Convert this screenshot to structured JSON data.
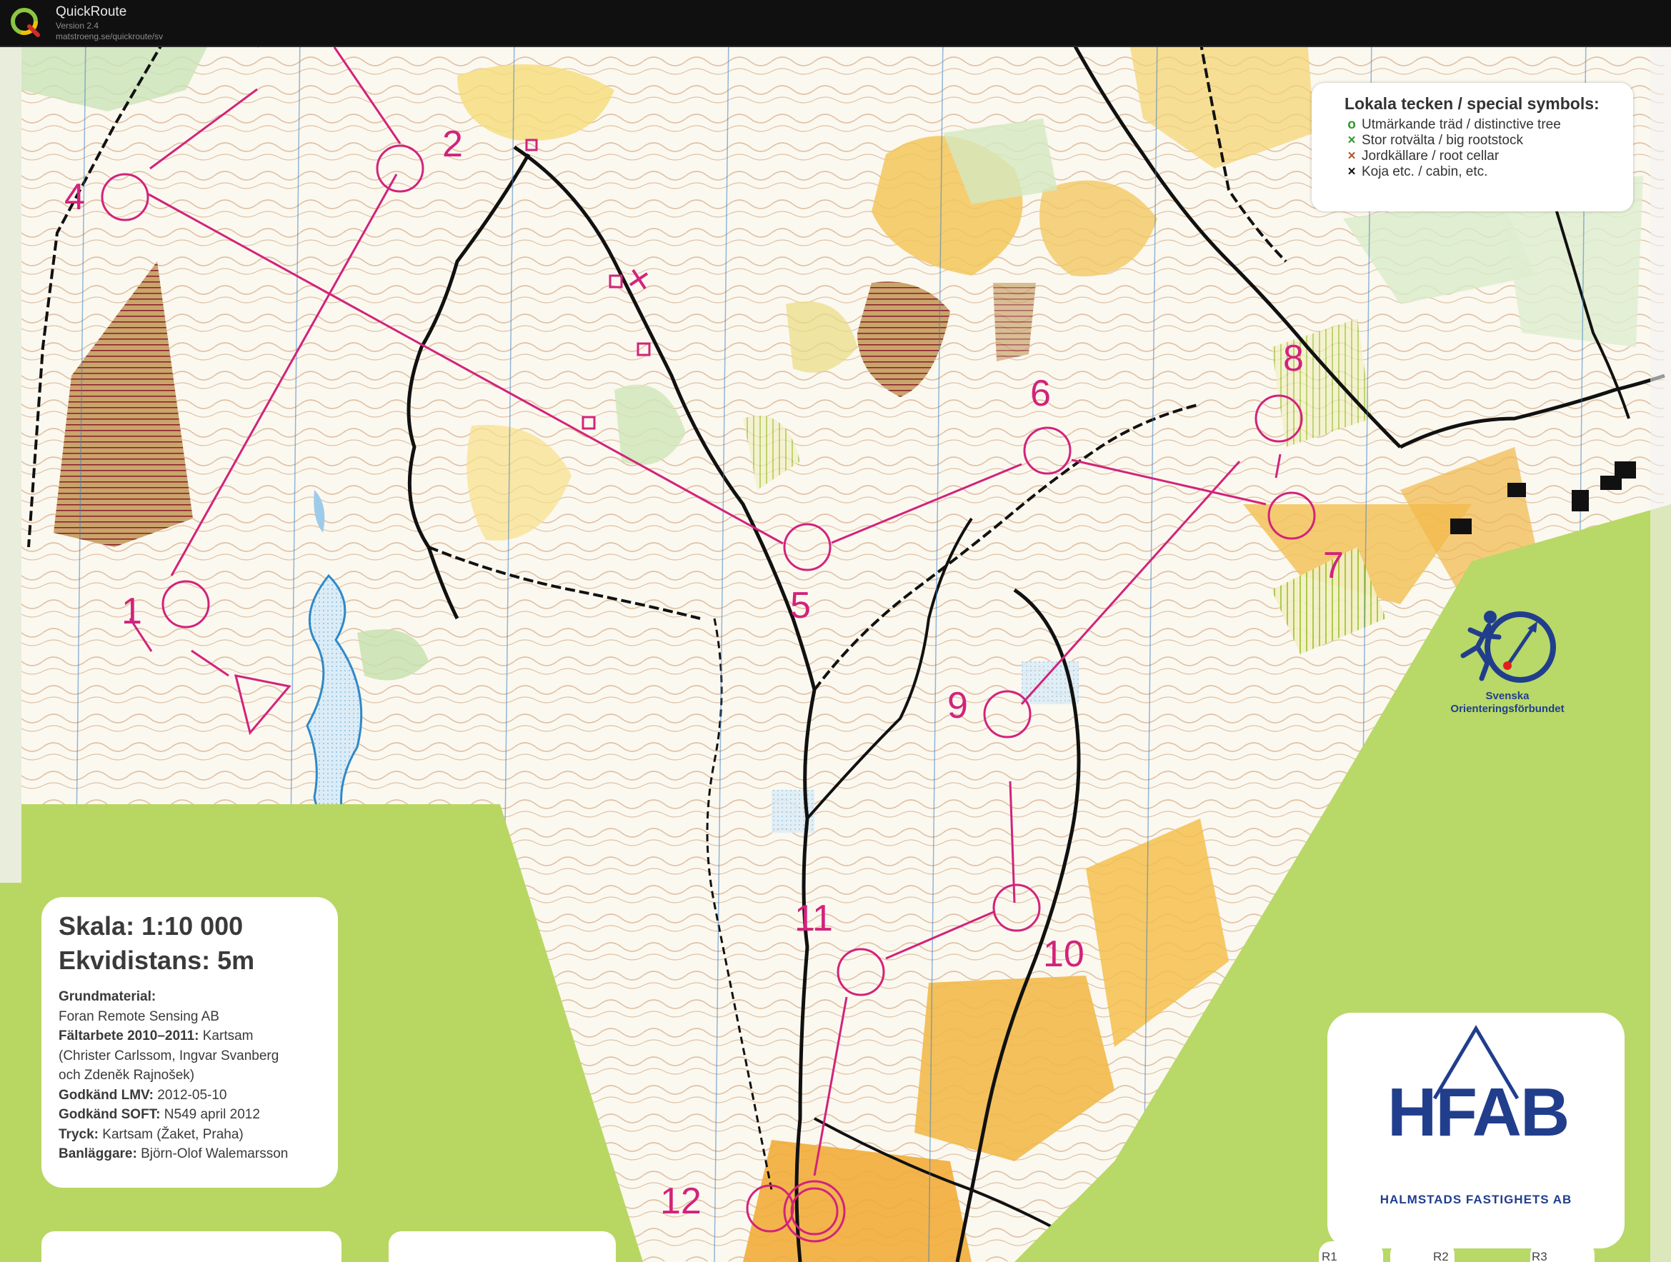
{
  "window": {
    "app_name": "QuickRoute",
    "version": "Version 2.4",
    "url": "matstroeng.se/quickroute/sv",
    "icon": "quickroute-q-icon"
  },
  "legend": {
    "title": "Lokala tecken / special symbols:",
    "items": [
      {
        "marker": "o",
        "color": "#2f9a2f",
        "label": "Utmärkande träd / distinctive tree"
      },
      {
        "marker": "×",
        "color": "#2f9a2f",
        "label": "Stor rotvälta / big rootstock"
      },
      {
        "marker": "×",
        "color": "#b0562b",
        "label": "Jordkällare / root cellar"
      },
      {
        "marker": "×",
        "color": "#111111",
        "label": "Koja etc. / cabin, etc."
      }
    ]
  },
  "info": {
    "scale": "Skala: 1:10 000",
    "contour": "Ekvidistans: 5m",
    "grund_label": "Grundmaterial:",
    "grund_value": "Foran Remote Sensing AB",
    "falt_label": "Fältarbete 2010–2011:",
    "falt_value": "Kartsam",
    "falt_line2": "(Christer Carlssom, Ingvar Svanberg",
    "falt_line3": "och Zdeněk Rajnošek)",
    "lmv_label": "Godkänd LMV:",
    "lmv_value": "2012-05-10",
    "soft_label": "Godkänd SOFT:",
    "soft_value": "N549 april 2012",
    "tryck_label": "Tryck:",
    "tryck_value": "Kartsam (Žaket, Praha)",
    "ban_label": "Banläggare:",
    "ban_value": "Björn-Olof Walemarsson"
  },
  "sponsor": {
    "letters": "HFAB",
    "name": "HALMSTADS FASTIGHETS AB"
  },
  "federation": {
    "line1": "Svenska",
    "line2": "Orienteringsförbundet",
    "logo": "orienteering-runner-compass-icon"
  },
  "course": {
    "color": "#d2237b",
    "controls": [
      "1",
      "2",
      "4",
      "5",
      "6",
      "7",
      "8",
      "9",
      "10",
      "11",
      "12"
    ]
  },
  "bottom_labels": [
    "R1",
    "R2",
    "R3"
  ]
}
